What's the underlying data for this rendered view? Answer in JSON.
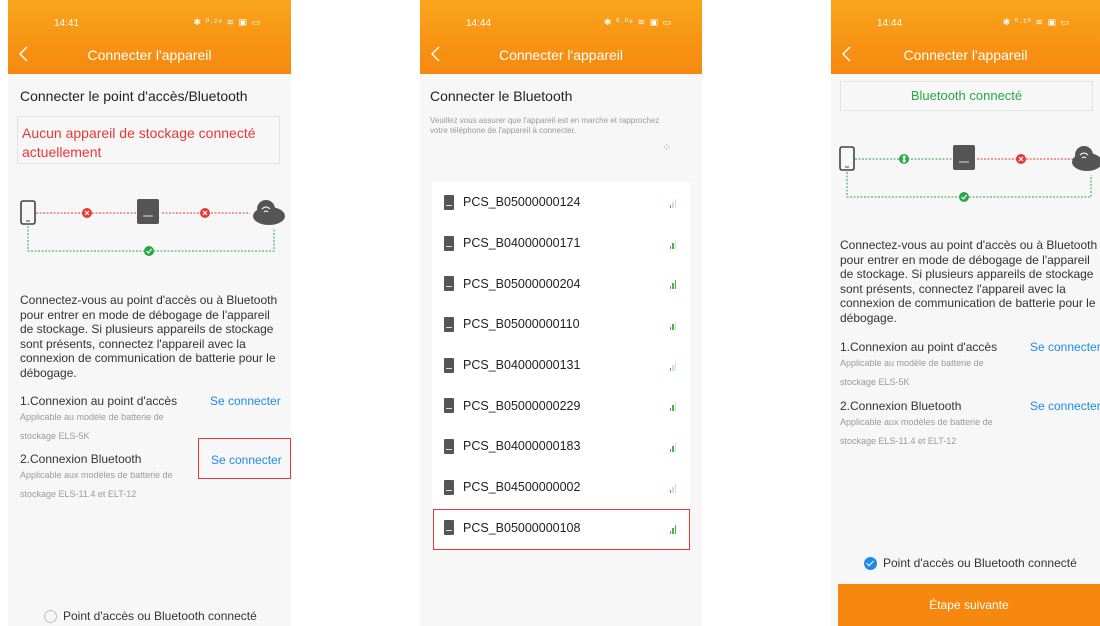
{
  "screen1": {
    "time": "14:41",
    "status_icons": "✱ ⁰·²⁹ ≋ ▣ ▭",
    "title": "Connecter l'appareil",
    "section_title": "Connecter le point d'accès/Bluetooth",
    "warning": "Aucun appareil de stockage connecté actuellement",
    "description": "Connectez-vous au point d'accès ou à Bluetooth pour entrer en mode de débogage de l'appareil de stockage. Si plusieurs appareils de stockage sont présents, connectez l'appareil avec la connexion de communication de batterie pour le débogage.",
    "options": [
      {
        "title": "1.Connexion au point d'accès",
        "subtitle": "Applicable au modèle de batterie de stockage ELS-5K",
        "action": "Se connecter"
      },
      {
        "title": "2.Connexion Bluetooth",
        "subtitle": "Applicable aux modèles de batterie de stockage ELS-11.4 et ELT-12",
        "action": "Se connecter"
      }
    ],
    "checkbox_label": "Point d'accès ou Bluetooth connecté"
  },
  "screen2": {
    "time": "14:44",
    "status_icons": "✱ ⁰·⁰⁸ ≋ ▣ ▭",
    "title": "Connecter l'appareil",
    "section_title": "Connecter le Bluetooth",
    "hint": "Veuillez vous assurer que l'appareil est en marche et rapprochez votre téléphone de l'appareil à connecter.",
    "devices": [
      {
        "name": "PCS_B05000000124",
        "signal_level": 1
      },
      {
        "name": "PCS_B04000000171",
        "signal_level": 2
      },
      {
        "name": "PCS_B05000000204",
        "signal_level": 3
      },
      {
        "name": "PCS_B05000000110",
        "signal_level": 2
      },
      {
        "name": "PCS_B04000000131",
        "signal_level": 1
      },
      {
        "name": "PCS_B05000000229",
        "signal_level": 2
      },
      {
        "name": "PCS_B04000000183",
        "signal_level": 2
      },
      {
        "name": "PCS_B04500000002",
        "signal_level": 1
      },
      {
        "name": "PCS_B05000000108",
        "signal_level": 3
      }
    ]
  },
  "screen3": {
    "time": "14:44",
    "status_icons": "✱ ⁰·¹⁰ ≋ ▣ ▭",
    "title": "Connecter l'appareil",
    "status": "Bluetooth connecté",
    "description": "Connectez-vous au point d'accès ou à Bluetooth pour entrer en mode de débogage de l'appareil de stockage. Si plusieurs appareils de stockage sont présents, connectez l'appareil avec la connexion de communication de batterie pour le débogage.",
    "options": [
      {
        "title": "1.Connexion au point d'accès",
        "subtitle": "Applicable au modèle de batterie de stockage ELS-5K",
        "action": "Se connecter"
      },
      {
        "title": "2.Connexion Bluetooth",
        "subtitle": "Applicable aux modèles de batterie de stockage ELS-11.4 et ELT-12",
        "action": "Se connecter"
      }
    ],
    "checkbox_label": "Point d'accès ou Bluetooth connecté",
    "next_button": "Étape suivante"
  },
  "colors": {
    "accent": "#f6880f",
    "error": "#e53935",
    "success": "#27a844",
    "link": "#1f8ae8"
  }
}
